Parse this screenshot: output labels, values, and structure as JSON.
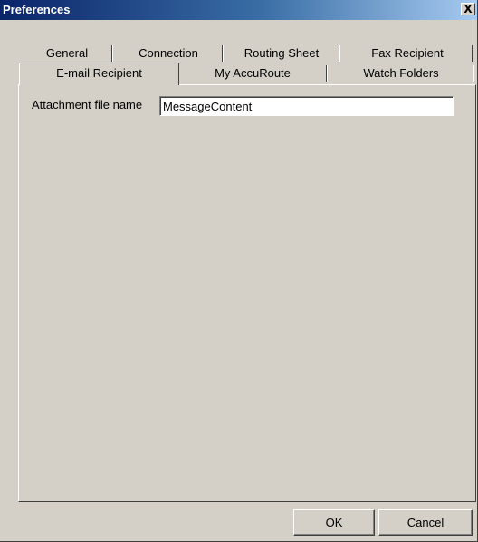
{
  "window": {
    "title": "Preferences",
    "close_label": "X"
  },
  "tabs": {
    "row1": [
      "General",
      "Connection",
      "Routing Sheet",
      "Fax Recipient"
    ],
    "row2": [
      "E-mail Recipient",
      "My AccuRoute",
      "Watch Folders"
    ],
    "active": "E-mail Recipient"
  },
  "email_tab": {
    "attachment_label": "Attachment file name",
    "attachment_value": "MessageContent"
  },
  "buttons": {
    "ok": "OK",
    "cancel": "Cancel"
  }
}
